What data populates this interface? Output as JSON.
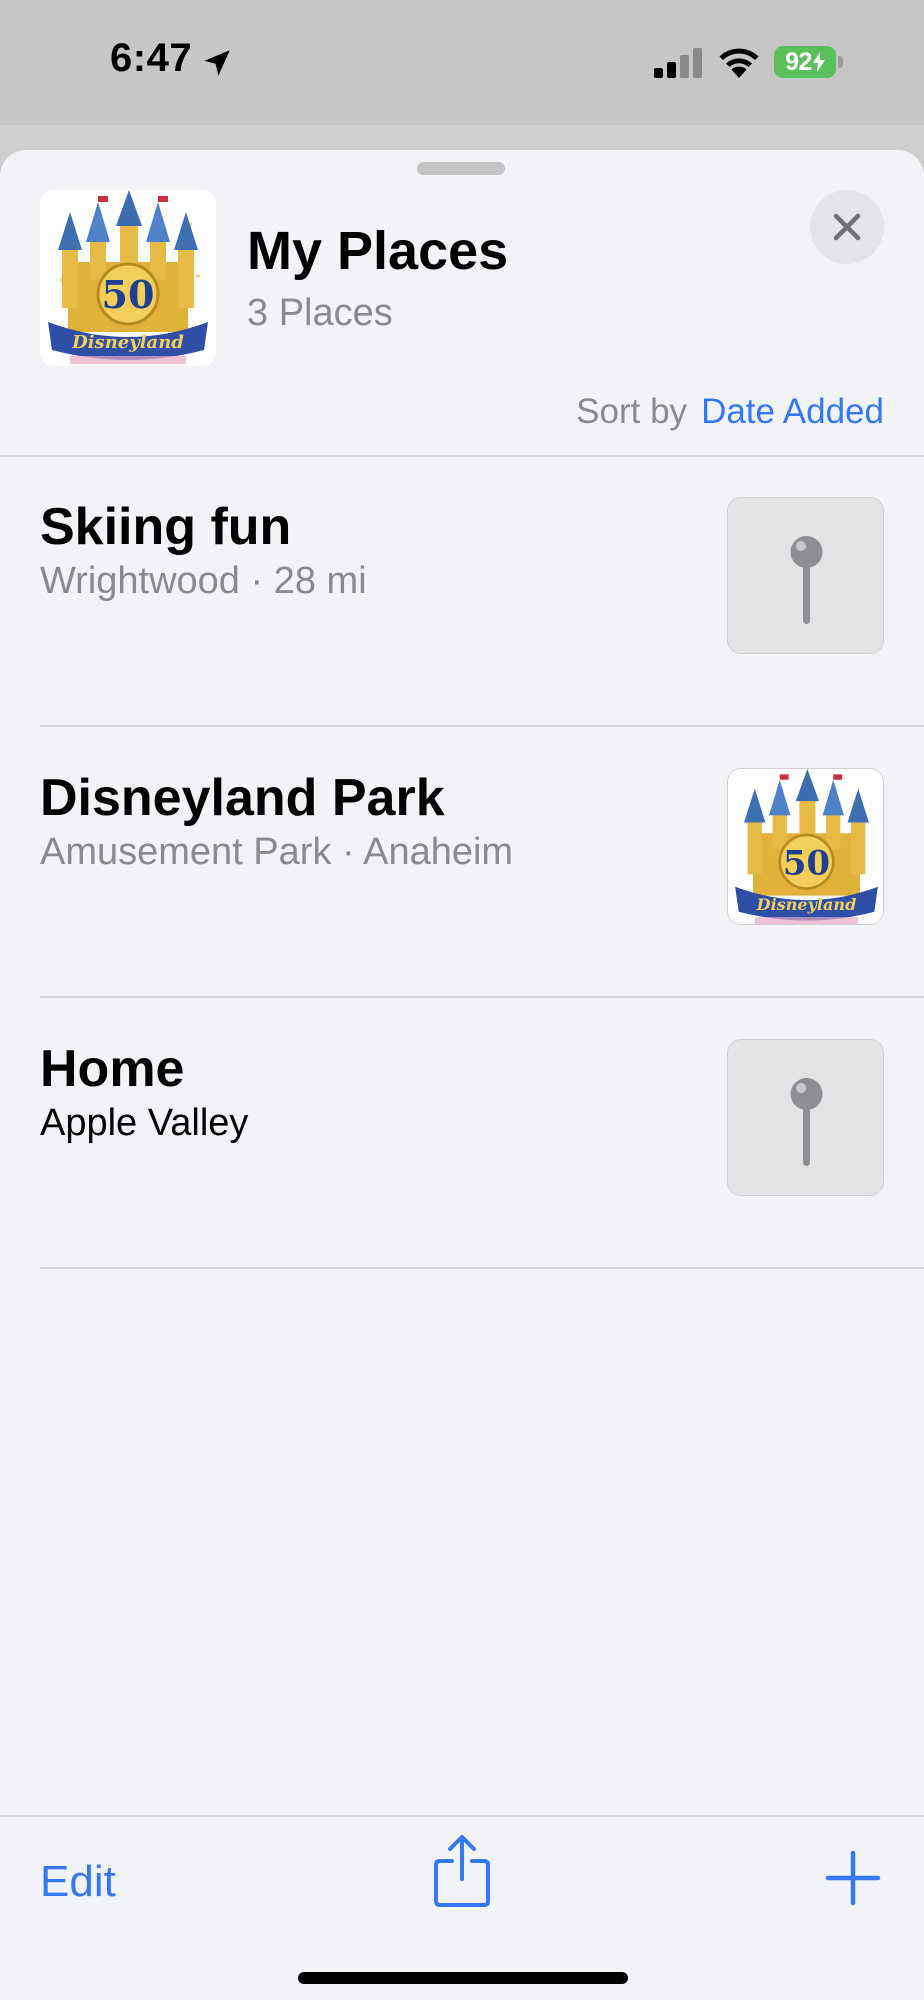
{
  "status_bar": {
    "time": "6:47",
    "battery": "92",
    "icons": [
      "location-arrow-icon",
      "cellular-signal-icon",
      "wifi-icon",
      "battery-charging-icon"
    ]
  },
  "guide": {
    "title": "My Places",
    "subtitle": "3 Places",
    "sort_label": "Sort by",
    "sort_value": "Date Added"
  },
  "places": [
    {
      "title": "Skiing fun",
      "subtitle": "Wrightwood · 28 mi",
      "thumb": "pin-icon"
    },
    {
      "title": "Disneyland Park",
      "subtitle": "Amusement Park · Anaheim",
      "thumb": "castle-image"
    },
    {
      "title": "Home",
      "subtitle": "Apple Valley",
      "thumb": "pin-icon"
    }
  ],
  "toolbar": {
    "edit_label": "Edit",
    "share_icon": "share-icon",
    "add_icon": "plus-icon"
  },
  "colors": {
    "accent": "#3478f6",
    "sheet_background": "#f2f3f6",
    "secondary_text": "#8a8a8e",
    "battery_green": "#5ac05b"
  }
}
